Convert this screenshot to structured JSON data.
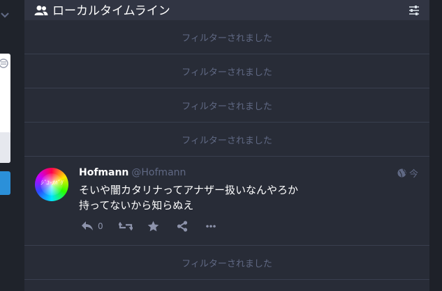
{
  "column": {
    "title": "ローカルタイムライン",
    "header_icon": "users-icon",
    "settings_icon": "sliders-icon"
  },
  "filtered_label": "フィルターされました",
  "filtered_rows": [
    {
      "label": "フィルターされました"
    },
    {
      "label": "フィルターされました"
    },
    {
      "label": "フィルターされました"
    },
    {
      "label": "フィルターされました"
    },
    {
      "label": "フィルターされました"
    }
  ],
  "status": {
    "display_name": "Hofmann",
    "acct": "@Hofmann",
    "time": "今",
    "visibility_icon": "globe-icon",
    "avatar_text": "ｼﾞﾕｰﾅﾊﾟﾘ",
    "content_lines": [
      "そいや闇カタリナってアナザー扱いなんやろか",
      "持ってないから知らぬえ"
    ],
    "reply_count": "0"
  },
  "colors": {
    "background": "#282c37",
    "header": "#313543",
    "muted_text": "#606984",
    "accent": "#2b90d9"
  }
}
